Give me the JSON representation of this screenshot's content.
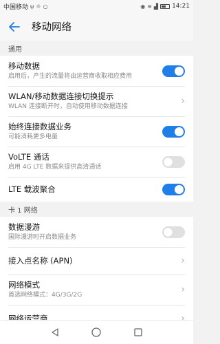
{
  "status_bar": {
    "carrier": "中国移动",
    "time": "14:21",
    "icons": [
      "usb-icon",
      "alarm-icon",
      "chat-icon",
      "eye-icon",
      "wifi-icon",
      "signal-icon",
      "battery-icon"
    ]
  },
  "header": {
    "title": "移动网络"
  },
  "sections": {
    "general": "通用",
    "sim1": "卡 1 网络"
  },
  "rows": {
    "mobile_data": {
      "title": "移动数据",
      "subtitle": "启用后，产生的流量将由运营商收取相应费用",
      "toggle": true
    },
    "wlan_switch": {
      "title": "WLAN/移动数据连接切换提示",
      "subtitle": "WLAN 连接断开时，自动使用移动数据连接"
    },
    "always_on": {
      "title": "始终连接数据业务",
      "subtitle": "可能消耗更多电量",
      "toggle": true
    },
    "volte": {
      "title": "VoLTE 通话",
      "subtitle": "启用 4G LTE 数据来提供高清通话",
      "toggle": false
    },
    "lte_ca": {
      "title": "LTE 载波聚合",
      "toggle": true
    },
    "roaming": {
      "title": "数据漫游",
      "subtitle": "国际漫游时开启数据业务",
      "toggle": false
    },
    "apn": {
      "title": "接入点名称 (APN)"
    },
    "network_mode": {
      "title": "网络模式",
      "subtitle": "首选网络模式：4G/3G/2G"
    },
    "operator": {
      "title": "网络运营商"
    }
  },
  "colors": {
    "accent": "#1f7ee8",
    "toggle_off": "#e0e0e0"
  }
}
